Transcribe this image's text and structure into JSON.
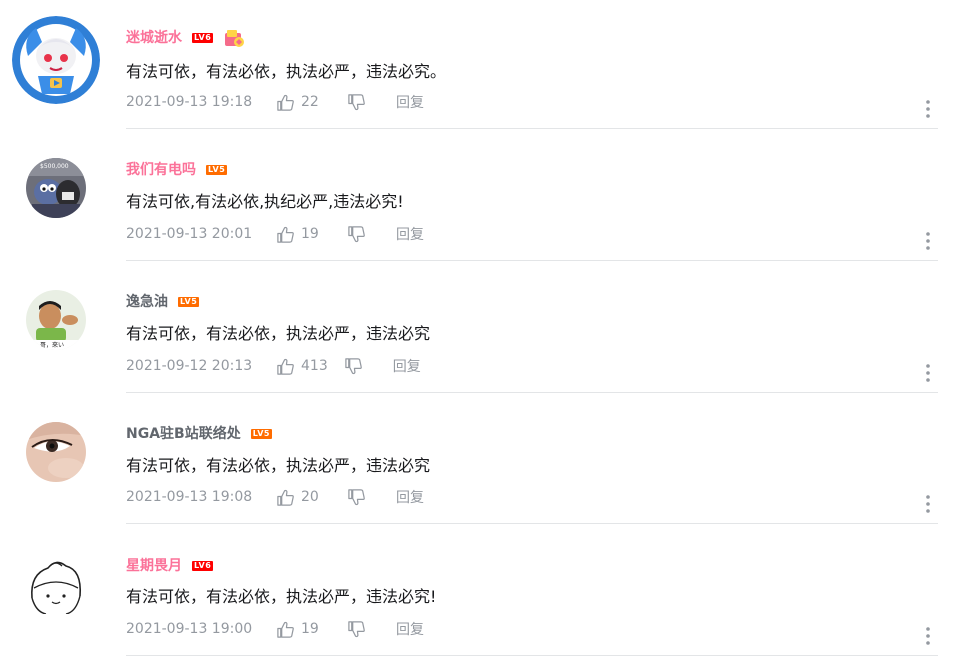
{
  "comments": [
    {
      "username": "迷城逝水",
      "name_color": "#fb7299",
      "level": "LV6",
      "level_color": "#ff0000",
      "has_badge": true,
      "text": "有法可依，有法必依，执法必严，违法必究。",
      "time": "2021-09-13 19:18",
      "likes": "22",
      "reply_label": "回复",
      "avatar_icon": "anime-girl-avatar"
    },
    {
      "username": "我们有电吗",
      "name_color": "#fb7299",
      "level": "LV5",
      "level_color": "#ff6c00",
      "has_badge": false,
      "text": "有法可依,有法必依,执纪必严,违法必究!",
      "time": "2021-09-13 20:01",
      "likes": "19",
      "reply_label": "回复",
      "avatar_icon": "cartoon-cat-avatar",
      "avatar_text": "$500,000"
    },
    {
      "username": "逸急油",
      "name_color": "#61666d",
      "level": "LV5",
      "level_color": "#ff6c00",
      "has_badge": false,
      "text": "有法可依，有法必依，执法必严，违法必究",
      "time": "2021-09-12 20:13",
      "likes": "413",
      "reply_label": "回复",
      "avatar_icon": "man-photo-avatar",
      "avatar_text": "哥，來い"
    },
    {
      "username": "NGA驻B站联络处",
      "name_color": "#61666d",
      "level": "LV5",
      "level_color": "#ff6c00",
      "has_badge": false,
      "text": "有法可依，有法必依，执法必严，违法必究",
      "time": "2021-09-13 19:08",
      "likes": "20",
      "reply_label": "回复",
      "avatar_icon": "eye-closeup-avatar"
    },
    {
      "username": "星期畏月",
      "name_color": "#fb7299",
      "level": "LV6",
      "level_color": "#ff0000",
      "has_badge": false,
      "text": "有法可依，有法必依，执法必严，违法必究!",
      "time": "2021-09-13 19:00",
      "likes": "19",
      "reply_label": "回复",
      "avatar_icon": "line-drawing-avatar"
    }
  ]
}
